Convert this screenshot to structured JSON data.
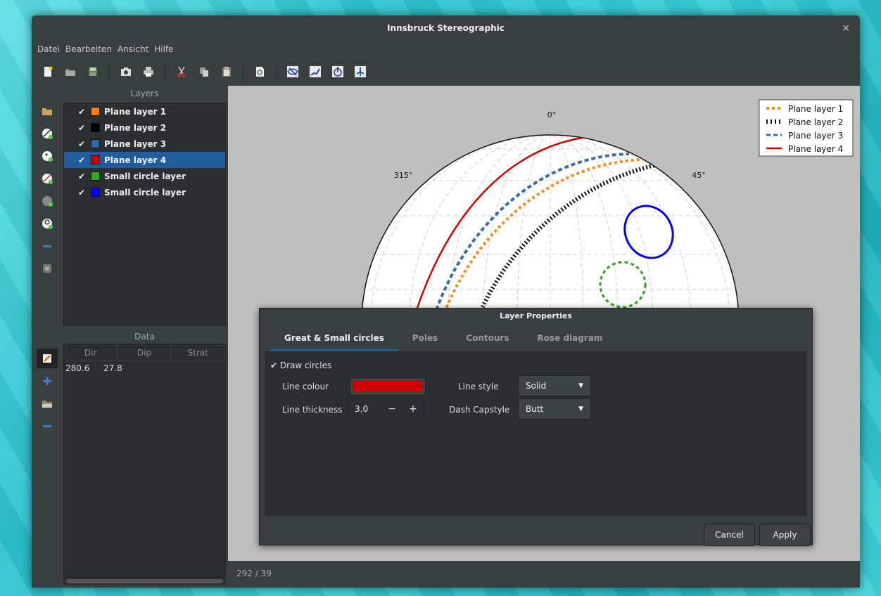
{
  "window": {
    "title": "Innsbruck Stereographic",
    "close": "×"
  },
  "menu": [
    "Datei",
    "Bearbeiten",
    "Ansicht",
    "Hilfe"
  ],
  "layers_header": "Layers",
  "layers": [
    {
      "label": "Plane layer 1",
      "color": "#ff8000",
      "checked": true,
      "selected": false
    },
    {
      "label": "Plane layer 2",
      "color": "#000000",
      "checked": true,
      "selected": false
    },
    {
      "label": "Plane layer 3",
      "color": "#3465a4",
      "checked": true,
      "selected": false
    },
    {
      "label": "Plane layer 4",
      "color": "#cc0000",
      "checked": true,
      "selected": true
    },
    {
      "label": "Small circle layer",
      "color": "#33aa22",
      "checked": true,
      "selected": false
    },
    {
      "label": "Small circle layer",
      "color": "#0000ff",
      "checked": true,
      "selected": false
    }
  ],
  "data_header": "Data",
  "data_table": {
    "columns": [
      "Dir",
      "Dip",
      "Strat"
    ],
    "rows": [
      [
        "280.6",
        "27.8",
        ""
      ]
    ]
  },
  "plot": {
    "labels": {
      "n": "0°",
      "nw": "315°",
      "ne": "45°"
    },
    "legend": [
      {
        "label": "Plane layer 1",
        "color": "#f28e1c",
        "style": "dotted"
      },
      {
        "label": "Plane layer 2",
        "color": "#000000",
        "style": "ticks"
      },
      {
        "label": "Plane layer 3",
        "color": "#3a6ea5",
        "style": "dashed"
      },
      {
        "label": "Plane layer 4",
        "color": "#cc0000",
        "style": "solid"
      }
    ]
  },
  "status": "292 / 39",
  "dialog": {
    "title": "Layer Properties",
    "tabs": [
      "Great & Small circles",
      "Poles",
      "Contours",
      "Rose diagram"
    ],
    "active_tab": 0,
    "draw_circles": "Draw circles",
    "draw_circles_checked": true,
    "line_colour_label": "Line colour",
    "line_colour": "#d00000",
    "line_style_label": "Line style",
    "line_style": "Solid",
    "line_thickness_label": "Line thickness",
    "line_thickness": "3,0",
    "dash_capstyle_label": "Dash Capstyle",
    "dash_capstyle": "Butt",
    "cancel": "Cancel",
    "apply": "Apply"
  }
}
